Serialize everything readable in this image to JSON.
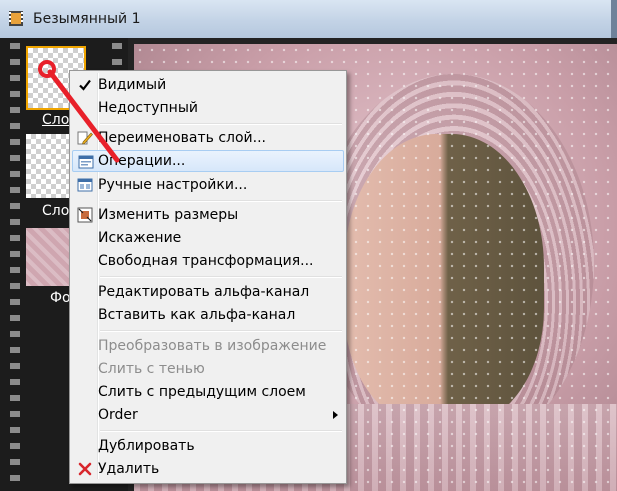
{
  "window": {
    "title": "Безымянный 1"
  },
  "layers": [
    {
      "label": "Сло"
    },
    {
      "label": "Сло"
    },
    {
      "label": "Фо"
    }
  ],
  "context_menu": {
    "items": {
      "visible": "Видимый",
      "locked": "Недоступный",
      "rename": "Переименовать слой...",
      "operations": "Операции...",
      "manual": "Ручные настройки...",
      "resize": "Изменить размеры",
      "distort": "Искажение",
      "free_transform": "Свободная трансформация...",
      "edit_alpha": "Редактировать альфа-канал",
      "paste_alpha": "Вставить как альфа-канал",
      "convert": "Преобразовать в изображение",
      "merge_shadow": "Слить с тенью",
      "merge_prev": "Слить с предыдущим слоем",
      "order": "Order",
      "duplicate": "Дублировать",
      "delete": "Удалить"
    }
  },
  "colors": {
    "highlight_border": "#a8cdf2",
    "annotation": "#e8202a"
  },
  "icons": [
    "film-icon",
    "checkmark-icon",
    "pencil-icon",
    "operations-icon",
    "manual-settings-icon",
    "resize-icon",
    "delete-x-icon",
    "submenu-arrow-icon"
  ]
}
